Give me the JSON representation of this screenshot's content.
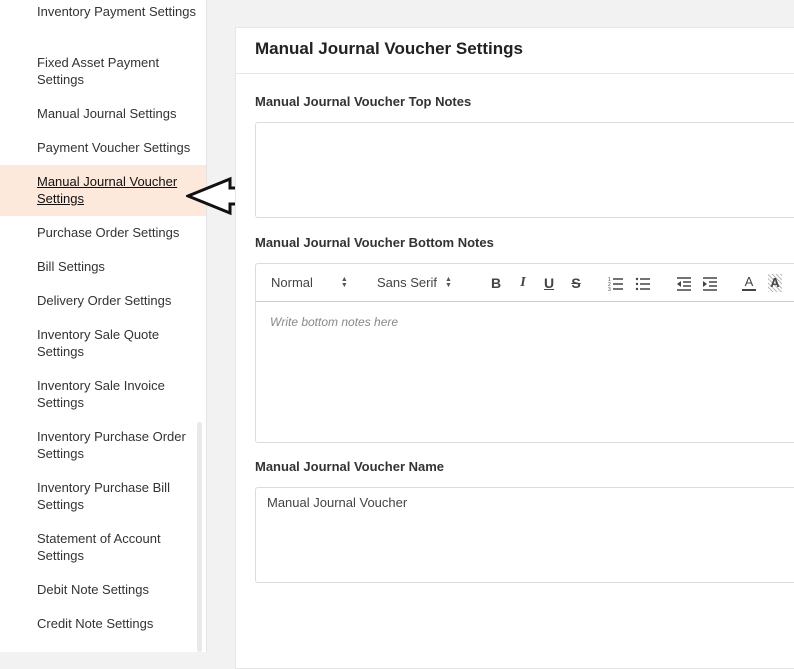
{
  "sidebar": {
    "items": [
      {
        "label": "Inventory Payment Settings"
      },
      {
        "label": "Fixed Asset Payment Settings"
      },
      {
        "label": "Manual Journal Settings"
      },
      {
        "label": "Payment Voucher Settings"
      },
      {
        "label": "Manual Journal Voucher Settings",
        "active": true
      },
      {
        "label": "Purchase Order Settings"
      },
      {
        "label": "Bill Settings"
      },
      {
        "label": "Delivery Order Settings"
      },
      {
        "label": "Inventory Sale Quote Settings"
      },
      {
        "label": "Inventory Sale Invoice Settings"
      },
      {
        "label": "Inventory Purchase Order Settings"
      },
      {
        "label": "Inventory Purchase Bill Settings"
      },
      {
        "label": "Statement of Account Settings"
      },
      {
        "label": "Debit Note Settings"
      },
      {
        "label": "Credit Note Settings"
      }
    ]
  },
  "main": {
    "title": "Manual Journal Voucher Settings",
    "top_notes_label": "Manual Journal Voucher Top Notes",
    "bottom_notes_label": "Manual Journal Voucher Bottom Notes",
    "bottom_notes_placeholder": "Write bottom notes here",
    "name_label": "Manual Journal Voucher Name",
    "name_value": "Manual Journal Voucher",
    "toolbar": {
      "heading_select": "Normal",
      "font_select": "Sans Serif",
      "bold": "B",
      "italic": "I",
      "underline": "U",
      "strike": "S",
      "text_color": "A",
      "highlight": "A"
    }
  },
  "colors": {
    "active_item_bg": "#fde9db",
    "page_bg": "#f2f2f2"
  }
}
